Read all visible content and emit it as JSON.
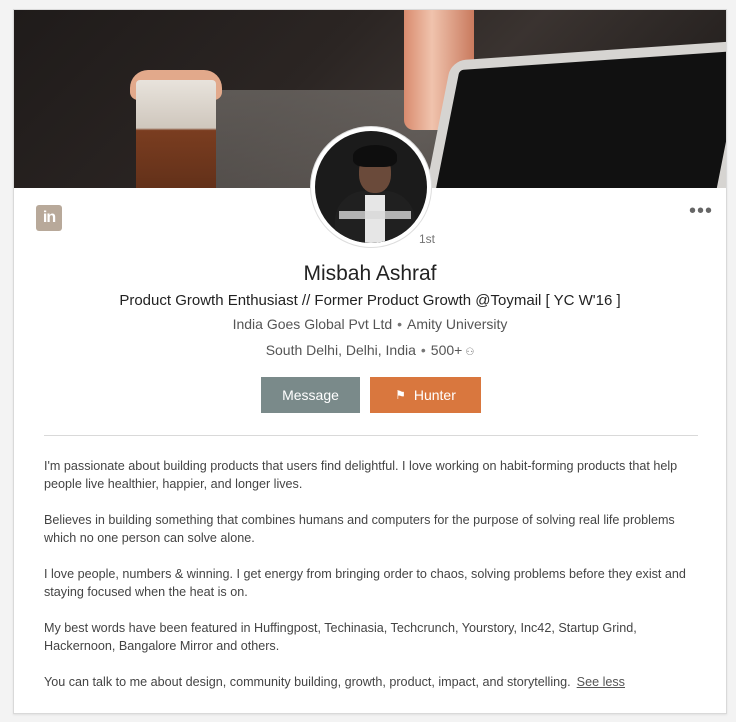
{
  "profile": {
    "degree": "1st",
    "name": "Misbah Ashraf",
    "headline": "Product Growth Enthusiast // Former Product Growth @Toymail [ YC W'16 ]",
    "company": "India Goes Global Pvt Ltd",
    "school": "Amity University",
    "location": "South Delhi, Delhi, India",
    "connections": "500+",
    "separator": "•"
  },
  "actions": {
    "message_label": "Message",
    "hunter_label": "Hunter"
  },
  "icons": {
    "logo": "in",
    "more": "•••",
    "connections_icon": "people-icon",
    "hunter_icon": "tag-icon"
  },
  "colors": {
    "message_button": "#7a8a8a",
    "hunter_button": "#d9773e"
  },
  "summary": {
    "paragraphs": [
      "I'm passionate about building products that users find delightful. I love working on habit-forming products that help people live healthier, happier, and longer lives.",
      "Believes in building something that combines humans and computers for the purpose of solving real life problems which no one person can solve alone.",
      "I love people, numbers & winning. I get energy from bringing order to chaos, solving problems before they exist and staying focused when the heat is on.",
      "My best words have been featured in Huffingpost, Techinasia, Techcrunch, Yourstory, Inc42, Startup Grind, Hackernoon, Bangalore Mirror and others.",
      "You can talk to me about design, community building, growth, product, impact, and storytelling."
    ],
    "see_less": "See less"
  }
}
